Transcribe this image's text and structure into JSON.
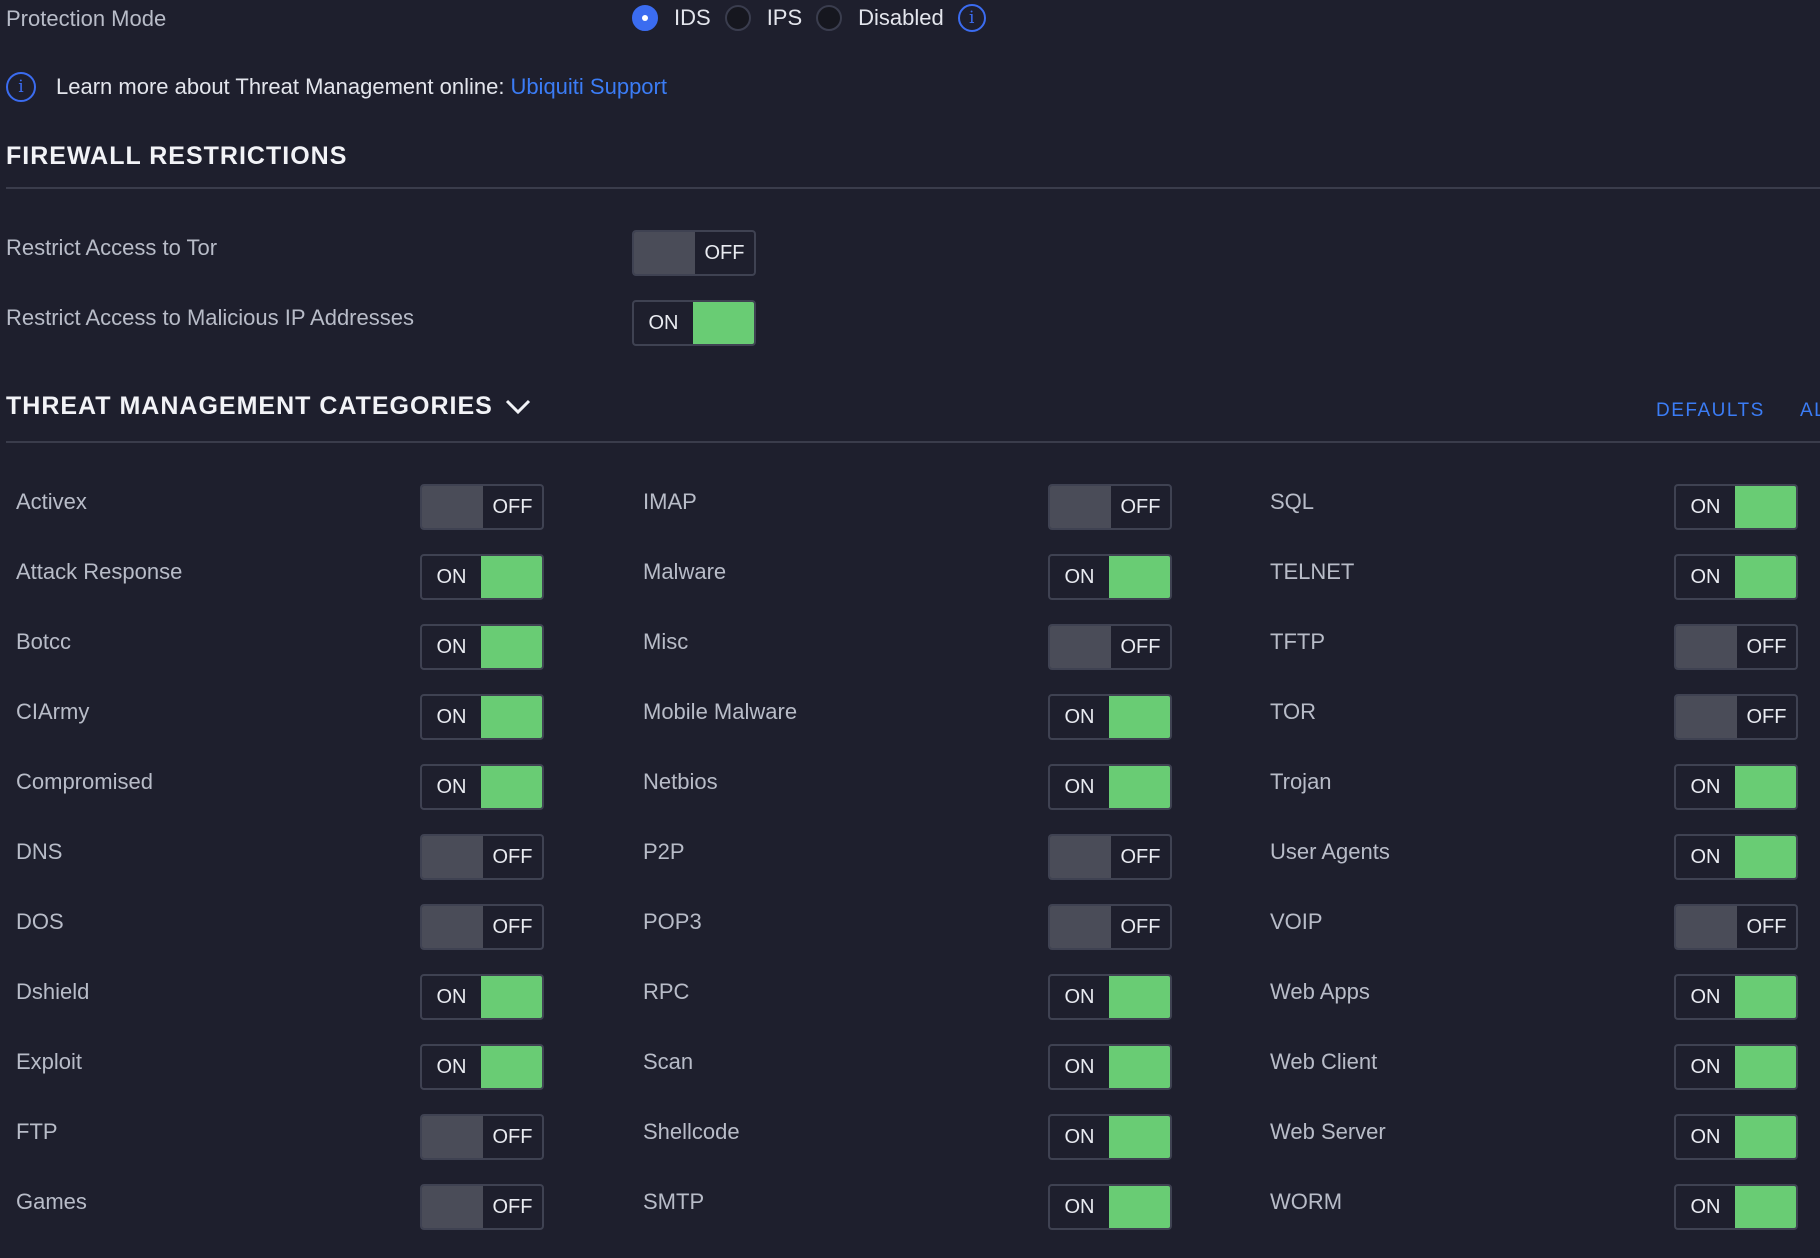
{
  "protection_mode": {
    "label": "Protection Mode",
    "options": [
      {
        "label": "IDS",
        "selected": true
      },
      {
        "label": "IPS",
        "selected": false
      },
      {
        "label": "Disabled",
        "selected": false
      }
    ],
    "info_glyph": "i"
  },
  "learn_more": {
    "text": "Learn more about Threat Management online:",
    "link": "Ubiquiti Support",
    "info_glyph": "i"
  },
  "firewall": {
    "title": "FIREWALL RESTRICTIONS",
    "items": [
      {
        "label": "Restrict Access to Tor",
        "state": "OFF"
      },
      {
        "label": "Restrict Access to Malicious IP Addresses",
        "state": "ON"
      }
    ]
  },
  "categories": {
    "title": "THREAT MANAGEMENT CATEGORIES",
    "defaults_label": "DEFAULTS",
    "all_label": "AL",
    "columns": [
      [
        {
          "label": "Activex",
          "state": "OFF"
        },
        {
          "label": "Attack Response",
          "state": "ON"
        },
        {
          "label": "Botcc",
          "state": "ON"
        },
        {
          "label": "CIArmy",
          "state": "ON"
        },
        {
          "label": "Compromised",
          "state": "ON"
        },
        {
          "label": "DNS",
          "state": "OFF"
        },
        {
          "label": "DOS",
          "state": "OFF"
        },
        {
          "label": "Dshield",
          "state": "ON"
        },
        {
          "label": "Exploit",
          "state": "ON"
        },
        {
          "label": "FTP",
          "state": "OFF"
        },
        {
          "label": "Games",
          "state": "OFF"
        }
      ],
      [
        {
          "label": "IMAP",
          "state": "OFF"
        },
        {
          "label": "Malware",
          "state": "ON"
        },
        {
          "label": "Misc",
          "state": "OFF"
        },
        {
          "label": "Mobile Malware",
          "state": "ON"
        },
        {
          "label": "Netbios",
          "state": "ON"
        },
        {
          "label": "P2P",
          "state": "OFF"
        },
        {
          "label": "POP3",
          "state": "OFF"
        },
        {
          "label": "RPC",
          "state": "ON"
        },
        {
          "label": "Scan",
          "state": "ON"
        },
        {
          "label": "Shellcode",
          "state": "ON"
        },
        {
          "label": "SMTP",
          "state": "ON"
        }
      ],
      [
        {
          "label": "SQL",
          "state": "ON"
        },
        {
          "label": "TELNET",
          "state": "ON"
        },
        {
          "label": "TFTP",
          "state": "OFF"
        },
        {
          "label": "TOR",
          "state": "OFF"
        },
        {
          "label": "Trojan",
          "state": "ON"
        },
        {
          "label": "User Agents",
          "state": "ON"
        },
        {
          "label": "VOIP",
          "state": "OFF"
        },
        {
          "label": "Web Apps",
          "state": "ON"
        },
        {
          "label": "Web Client",
          "state": "ON"
        },
        {
          "label": "Web Server",
          "state": "ON"
        },
        {
          "label": "WORM",
          "state": "ON"
        }
      ]
    ]
  },
  "colors": {
    "background": "#1e1f2d",
    "accent": "#3b6cf0",
    "link": "#3b7cf5",
    "toggle_on": "#69cc74",
    "toggle_off": "#4a4c58"
  }
}
